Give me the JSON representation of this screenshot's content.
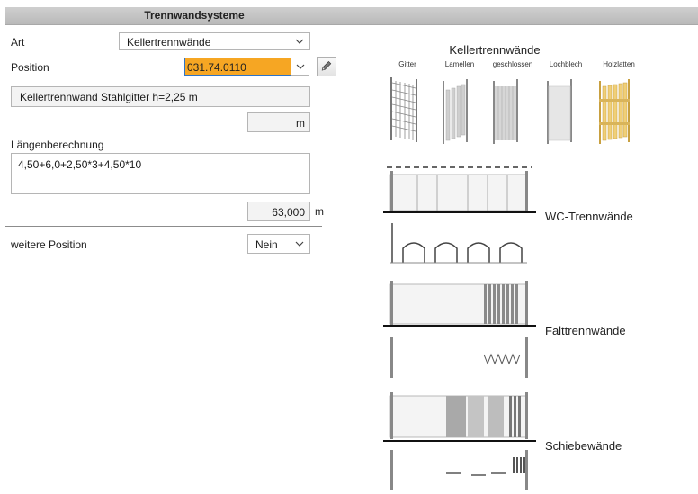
{
  "header": {
    "title": "Trennwandsysteme"
  },
  "form": {
    "art_label": "Art",
    "art_value": "Kellertrennwände",
    "position_label": "Position",
    "position_value": "031.74.0110",
    "description": "Kellertrennwand Stahlgitter h=2,25 m",
    "unit_field": "",
    "unit": "m",
    "laengen_label": "Längenberechnung",
    "formula": "4,50+6,0+2,50*3+4,50*10",
    "result_value": "63,000",
    "result_unit": "m",
    "weitere_label": "weitere Position",
    "weitere_value": "Nein"
  },
  "illustration": {
    "keller_title": "Kellertrennwände",
    "keller_types": [
      "Gitter",
      "Lamellen",
      "geschlossen",
      "Lochblech",
      "Holzlatten"
    ],
    "wc_label": "WC-Trennwände",
    "falt_label": "Falttrennwände",
    "schiebe_label": "Schiebewände"
  },
  "colors": {
    "position_highlight": "#f6a623",
    "title_bar": "#c4c4c4",
    "wood": "#e8c46a"
  }
}
